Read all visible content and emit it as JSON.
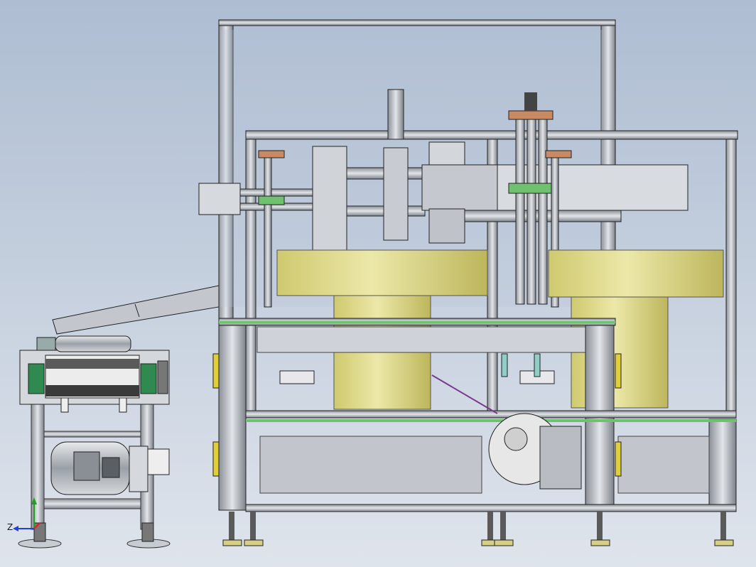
{
  "viewport": {
    "background_top": "#aebdd2",
    "background_bottom": "#dfe4ec"
  },
  "colors": {
    "frame_silver": "#c9cdd3",
    "frame_dark": "#5a5e66",
    "accent_green": "#6fc06f",
    "drum_yellow": "#e3de95",
    "pad_copper": "#c78a63",
    "motor_gray": "#b8bcc2",
    "floor_feet": "#d8cf86"
  },
  "triad": {
    "z_axis_label": "Z",
    "axis_x_color": "#e02020",
    "axis_y_color": "#20a020",
    "axis_z_color": "#2040e0"
  }
}
